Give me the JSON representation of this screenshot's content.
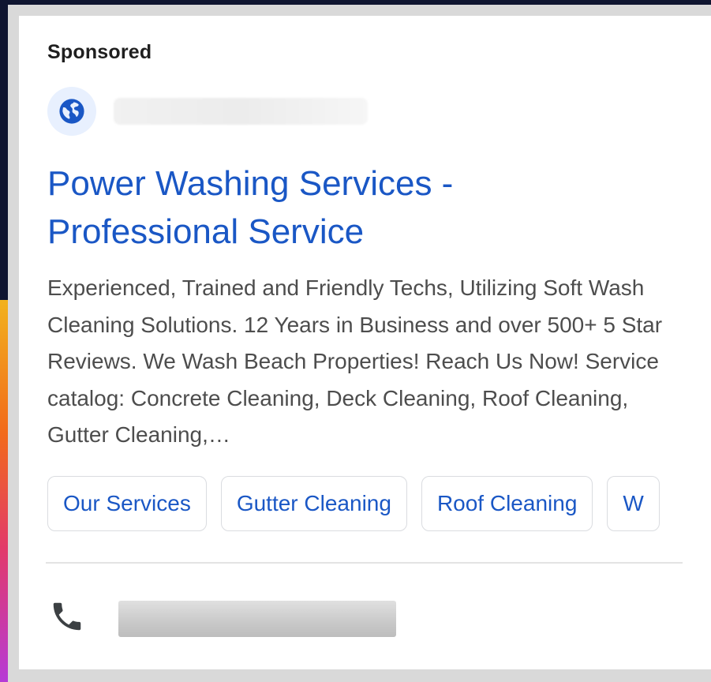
{
  "ad": {
    "sponsored_label": "Sponsored",
    "site_icon": "globe-icon",
    "title_line1": "Power Washing Services -",
    "title_line2": "Professional Service",
    "description": "Experienced, Trained and Friendly Techs, Utilizing Soft Wash Cleaning Solutions. 12 Years in Business and over 500+ 5 Star Reviews. We Wash Beach Properties! Reach Us Now! Service catalog: Concrete Cleaning, Deck Cleaning, Roof Cleaning, Gutter Cleaning,…",
    "sitelinks": [
      "Our Services",
      "Gutter Cleaning",
      "Roof Cleaning",
      "W"
    ],
    "phone_icon": "phone-icon"
  },
  "colors": {
    "link": "#1a57c5",
    "text": "#4d4d4d",
    "globe_bg": "#e8f0fe",
    "globe_fg": "#1a57c5"
  }
}
